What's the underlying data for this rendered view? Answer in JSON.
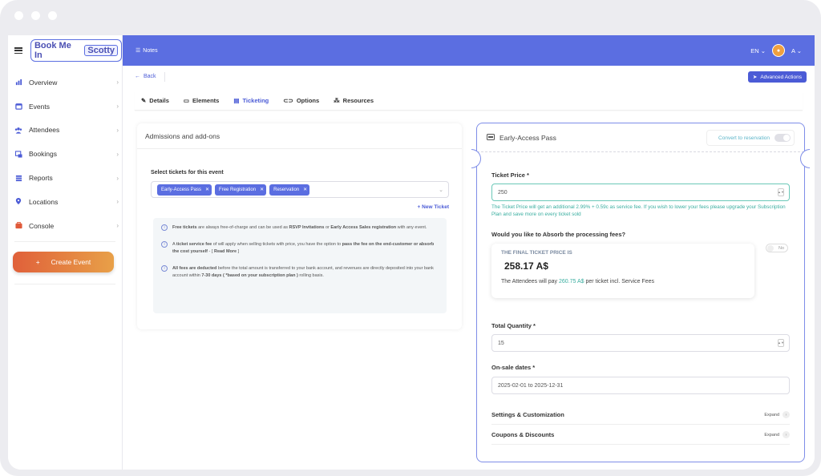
{
  "app": {
    "logo_text": "Book Me In",
    "logo_badge": "Scotty"
  },
  "topbar": {
    "notes_label": "Notes",
    "language": "EN",
    "user_initial": "A"
  },
  "sidebar": {
    "items": [
      {
        "label": "Overview",
        "icon": "chart-icon"
      },
      {
        "label": "Events",
        "icon": "calendar-icon"
      },
      {
        "label": "Attendees",
        "icon": "users-icon"
      },
      {
        "label": "Bookings",
        "icon": "bookings-icon"
      },
      {
        "label": "Reports",
        "icon": "reports-icon"
      },
      {
        "label": "Locations",
        "icon": "location-icon"
      },
      {
        "label": "Console",
        "icon": "console-icon"
      }
    ],
    "create_label": "Create Event"
  },
  "header": {
    "back_label": "Back",
    "advanced_label": "Advanced Actions"
  },
  "tabs": [
    {
      "label": "Details"
    },
    {
      "label": "Elements"
    },
    {
      "label": "Ticketing"
    },
    {
      "label": "Options"
    },
    {
      "label": "Resources"
    }
  ],
  "admissions": {
    "title": "Admissions and add-ons",
    "select_label": "Select tickets for this event",
    "tags": [
      "Early-Access Pass",
      "Free Registration",
      "Reservation"
    ],
    "new_ticket": "+ New Ticket",
    "info": {
      "p1_a": "Free tickets",
      "p1_b": " are always free-of-charge and can be used as ",
      "p1_c": "RSVP Invitations",
      "p1_d": " or ",
      "p1_e": "Early Access Sales registration",
      "p1_f": " with any event.",
      "p2_a": "A ",
      "p2_b": "ticket service fee",
      "p2_c": " of will apply when selling tickets with price, you have the option to ",
      "p2_d": "pass the fee on the end-customer or absorb the cost yourself",
      "p2_e": " - [ ",
      "p2_f": "Read More",
      "p2_g": " ]",
      "p3_a": "All fees are deducted",
      "p3_b": " before the total amount is transferred to your bank account, and revenues are directly deposited into your bank account within ",
      "p3_c": "7-30 days ( *based on your subscription plan )",
      "p3_d": " rolling basis."
    }
  },
  "ticket": {
    "name": "Early-Access Pass",
    "convert_label": "Convert to reservation",
    "price_label": "Ticket Price *",
    "price_value": "250",
    "fee_note": "The Ticket Price will get an additional 2.99% + 0.59c as service fee. If you wish to lower your fees please upgrade your Subscription Plan and save more on every ticket sold",
    "absorb_label": "Would you like to Absorb the processing fees?",
    "absorb_toggle": "No",
    "final_label": "THE FINAL TICKET PRICE IS",
    "final_value": "258.17 A$",
    "attendee_prefix": "The Attendees will pay ",
    "attendee_amount": "260.75 A$",
    "attendee_suffix": " per ticket incl. Service Fees",
    "qty_label": "Total Quantity *",
    "qty_value": "15",
    "dates_label": "On-sale dates *",
    "dates_value": "2025-02-01 to 2025-12-31",
    "settings_label": "Settings & Customization",
    "coupons_label": "Coupons & Discounts",
    "expand_label": "Expand"
  }
}
